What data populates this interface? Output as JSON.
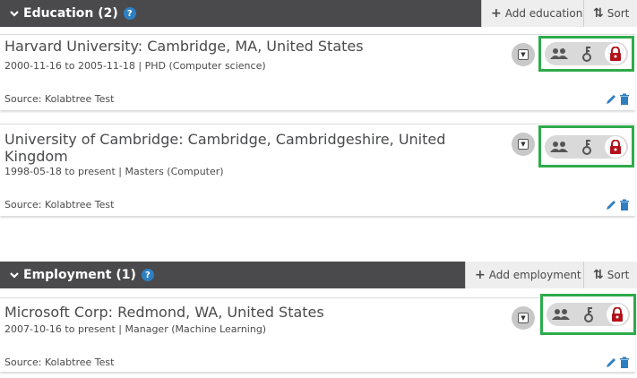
{
  "education": {
    "title": "Education (2)",
    "help": "?",
    "add_label": "Add education",
    "sort_label": "Sort",
    "items": [
      {
        "title": "Harvard University: Cambridge, MA, United States",
        "dates": "2000-11-16 to 2005-11-18",
        "separator": "|",
        "degree": "PHD",
        "field": "(Computer science)",
        "source": "Source: Kolabtree Test"
      },
      {
        "title": "University of Cambridge: Cambridge, Cambridgeshire, United Kingdom",
        "dates": "1998-05-18 to present",
        "separator": "|",
        "degree": "Masters",
        "field": "(Computer)",
        "source": "Source: Kolabtree Test"
      }
    ]
  },
  "employment": {
    "title": "Employment (1)",
    "help": "?",
    "add_label": "Add employment",
    "sort_label": "Sort",
    "items": [
      {
        "title": "Microsoft Corp: Redmond, WA, United States",
        "dates": "2007-10-16 to present",
        "separator": "|",
        "degree": "Manager",
        "field": "(Machine Learning)",
        "source": "Source: Kolabtree Test"
      }
    ]
  },
  "icons": {
    "add": "+",
    "sort": "⇅",
    "group": "group-icon",
    "key": "key-icon",
    "lock": "lock-icon",
    "edit": "pencil-icon",
    "delete": "trash-icon"
  },
  "colors": {
    "header_bg": "#4a4a4c",
    "button_bg": "#eeeeee",
    "help_blue": "#2e7fc1",
    "highlight_green": "#2eab4a",
    "lock_red": "#b3121b",
    "edit_blue": "#2e7fc1"
  }
}
